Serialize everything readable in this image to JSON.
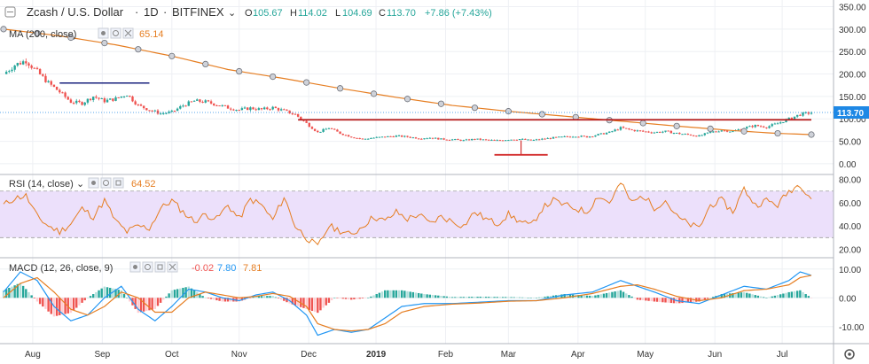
{
  "header": {
    "symbol": "Zcash / U.S. Dollar",
    "interval": "1D",
    "exchange": "BITFINEX",
    "sep": "·",
    "open_label": "O",
    "open": "105.67",
    "high_label": "H",
    "high": "114.02",
    "low_label": "L",
    "low": "104.69",
    "close_label": "C",
    "close": "113.70",
    "change": "+7.86 (+7.43%)"
  },
  "indicators": {
    "ma": {
      "label": "MA (200, close)",
      "value": "65.14"
    },
    "rsi": {
      "label": "RSI (14, close)",
      "value": "64.52"
    },
    "macd": {
      "label": "MACD (12, 26, close, 9)",
      "hist": "-0.02",
      "macd": "7.80",
      "signal": "7.81"
    }
  },
  "price_tag": "113.70",
  "colors": {
    "up": "#26a69a",
    "down": "#ef5350",
    "ma": "#e67e22",
    "rsi": "#e67e22",
    "macd_line": "#2196f3",
    "signal_line": "#e67e22",
    "rsi_band": "#ece0fb",
    "drawing_blue": "#1a237e",
    "drawing_red": "#b71c1c",
    "price_tag": "#1e88e5"
  },
  "chart_data": [
    {
      "type": "candlestick",
      "title": "Zcash / U.S. Dollar · 1D · BITFINEX",
      "x_labels": [
        "Aug",
        "Sep",
        "Oct",
        "Nov",
        "Dec",
        "2019",
        "Feb",
        "Mar",
        "Apr",
        "May",
        "Jun",
        "Jul"
      ],
      "yticks": [
        0,
        50,
        100,
        150,
        200,
        250,
        300,
        350
      ],
      "ytick_labels": [
        "0.00",
        "50.00",
        "100.00",
        "150.00",
        "200.00",
        "250.00",
        "300.00",
        "350.00"
      ],
      "ylim": [
        -10,
        355
      ],
      "close_series": [
        {
          "x": 0,
          "y": 200
        },
        {
          "x": 4,
          "y": 220
        },
        {
          "x": 8,
          "y": 230
        },
        {
          "x": 12,
          "y": 205
        },
        {
          "x": 16,
          "y": 180
        },
        {
          "x": 20,
          "y": 160
        },
        {
          "x": 24,
          "y": 138
        },
        {
          "x": 28,
          "y": 135
        },
        {
          "x": 32,
          "y": 150
        },
        {
          "x": 36,
          "y": 140
        },
        {
          "x": 40,
          "y": 145
        },
        {
          "x": 44,
          "y": 155
        },
        {
          "x": 48,
          "y": 130
        },
        {
          "x": 52,
          "y": 120
        },
        {
          "x": 56,
          "y": 112
        },
        {
          "x": 60,
          "y": 115
        },
        {
          "x": 64,
          "y": 130
        },
        {
          "x": 68,
          "y": 140
        },
        {
          "x": 72,
          "y": 138
        },
        {
          "x": 76,
          "y": 132
        },
        {
          "x": 80,
          "y": 125
        },
        {
          "x": 84,
          "y": 120
        },
        {
          "x": 88,
          "y": 124
        },
        {
          "x": 92,
          "y": 121
        },
        {
          "x": 96,
          "y": 125
        },
        {
          "x": 100,
          "y": 118
        },
        {
          "x": 104,
          "y": 110
        },
        {
          "x": 108,
          "y": 90
        },
        {
          "x": 112,
          "y": 70
        },
        {
          "x": 116,
          "y": 80
        },
        {
          "x": 120,
          "y": 68
        },
        {
          "x": 124,
          "y": 60
        },
        {
          "x": 128,
          "y": 55
        },
        {
          "x": 132,
          "y": 58
        },
        {
          "x": 136,
          "y": 60
        },
        {
          "x": 140,
          "y": 62
        },
        {
          "x": 144,
          "y": 60
        },
        {
          "x": 148,
          "y": 57
        },
        {
          "x": 152,
          "y": 58
        },
        {
          "x": 156,
          "y": 55
        },
        {
          "x": 160,
          "y": 54
        },
        {
          "x": 164,
          "y": 52
        },
        {
          "x": 168,
          "y": 55
        },
        {
          "x": 172,
          "y": 53
        },
        {
          "x": 176,
          "y": 52
        },
        {
          "x": 180,
          "y": 54
        },
        {
          "x": 184,
          "y": 55
        },
        {
          "x": 188,
          "y": 52
        },
        {
          "x": 192,
          "y": 55
        },
        {
          "x": 196,
          "y": 58
        },
        {
          "x": 200,
          "y": 60
        },
        {
          "x": 204,
          "y": 62
        },
        {
          "x": 208,
          "y": 60
        },
        {
          "x": 212,
          "y": 65
        },
        {
          "x": 216,
          "y": 70
        },
        {
          "x": 220,
          "y": 80
        },
        {
          "x": 224,
          "y": 75
        },
        {
          "x": 228,
          "y": 72
        },
        {
          "x": 232,
          "y": 70
        },
        {
          "x": 236,
          "y": 72
        },
        {
          "x": 240,
          "y": 68
        },
        {
          "x": 244,
          "y": 65
        },
        {
          "x": 248,
          "y": 62
        },
        {
          "x": 252,
          "y": 70
        },
        {
          "x": 256,
          "y": 75
        },
        {
          "x": 260,
          "y": 72
        },
        {
          "x": 264,
          "y": 80
        },
        {
          "x": 268,
          "y": 85
        },
        {
          "x": 272,
          "y": 82
        },
        {
          "x": 276,
          "y": 90
        },
        {
          "x": 280,
          "y": 100
        },
        {
          "x": 284,
          "y": 110
        },
        {
          "x": 288,
          "y": 114
        }
      ],
      "ma_series": [
        {
          "x": 0,
          "y": 300
        },
        {
          "x": 20,
          "y": 285
        },
        {
          "x": 40,
          "y": 265
        },
        {
          "x": 60,
          "y": 240
        },
        {
          "x": 80,
          "y": 210
        },
        {
          "x": 100,
          "y": 190
        },
        {
          "x": 120,
          "y": 168
        },
        {
          "x": 140,
          "y": 148
        },
        {
          "x": 160,
          "y": 130
        },
        {
          "x": 180,
          "y": 117
        },
        {
          "x": 200,
          "y": 106
        },
        {
          "x": 220,
          "y": 95
        },
        {
          "x": 240,
          "y": 84
        },
        {
          "x": 260,
          "y": 74
        },
        {
          "x": 275,
          "y": 68
        },
        {
          "x": 288,
          "y": 65
        }
      ],
      "drawings": {
        "blue_line": {
          "x1": 20,
          "x2": 52,
          "y": 180
        },
        "red_resistance": {
          "x1": 105,
          "x2": 288,
          "y": 98
        },
        "red_support": {
          "x1": 175,
          "x2": 194,
          "y": 20,
          "stem_top": 52
        }
      }
    },
    {
      "type": "line",
      "title": "RSI (14, close)",
      "yticks": [
        20,
        40,
        60,
        80
      ],
      "ytick_labels": [
        "20.00",
        "40.00",
        "60.00",
        "80.00"
      ],
      "ylim": [
        15,
        82
      ],
      "band": [
        30,
        70
      ],
      "series": [
        {
          "x": 0,
          "y": 58
        },
        {
          "x": 4,
          "y": 64
        },
        {
          "x": 8,
          "y": 66
        },
        {
          "x": 12,
          "y": 48
        },
        {
          "x": 16,
          "y": 40
        },
        {
          "x": 20,
          "y": 35
        },
        {
          "x": 24,
          "y": 42
        },
        {
          "x": 28,
          "y": 55
        },
        {
          "x": 32,
          "y": 48
        },
        {
          "x": 36,
          "y": 62
        },
        {
          "x": 40,
          "y": 44
        },
        {
          "x": 44,
          "y": 35
        },
        {
          "x": 48,
          "y": 40
        },
        {
          "x": 52,
          "y": 38
        },
        {
          "x": 56,
          "y": 55
        },
        {
          "x": 60,
          "y": 62
        },
        {
          "x": 64,
          "y": 52
        },
        {
          "x": 68,
          "y": 44
        },
        {
          "x": 72,
          "y": 50
        },
        {
          "x": 76,
          "y": 46
        },
        {
          "x": 80,
          "y": 58
        },
        {
          "x": 84,
          "y": 46
        },
        {
          "x": 88,
          "y": 63
        },
        {
          "x": 92,
          "y": 58
        },
        {
          "x": 96,
          "y": 45
        },
        {
          "x": 100,
          "y": 65
        },
        {
          "x": 104,
          "y": 40
        },
        {
          "x": 108,
          "y": 30
        },
        {
          "x": 112,
          "y": 22
        },
        {
          "x": 116,
          "y": 40
        },
        {
          "x": 120,
          "y": 36
        },
        {
          "x": 124,
          "y": 32
        },
        {
          "x": 128,
          "y": 40
        },
        {
          "x": 132,
          "y": 48
        },
        {
          "x": 136,
          "y": 44
        },
        {
          "x": 140,
          "y": 52
        },
        {
          "x": 144,
          "y": 46
        },
        {
          "x": 148,
          "y": 50
        },
        {
          "x": 152,
          "y": 42
        },
        {
          "x": 156,
          "y": 48
        },
        {
          "x": 160,
          "y": 44
        },
        {
          "x": 164,
          "y": 40
        },
        {
          "x": 168,
          "y": 52
        },
        {
          "x": 172,
          "y": 46
        },
        {
          "x": 176,
          "y": 42
        },
        {
          "x": 180,
          "y": 50
        },
        {
          "x": 184,
          "y": 44
        },
        {
          "x": 188,
          "y": 40
        },
        {
          "x": 192,
          "y": 55
        },
        {
          "x": 196,
          "y": 62
        },
        {
          "x": 200,
          "y": 58
        },
        {
          "x": 204,
          "y": 55
        },
        {
          "x": 208,
          "y": 52
        },
        {
          "x": 212,
          "y": 66
        },
        {
          "x": 216,
          "y": 60
        },
        {
          "x": 220,
          "y": 77
        },
        {
          "x": 224,
          "y": 60
        },
        {
          "x": 228,
          "y": 66
        },
        {
          "x": 232,
          "y": 56
        },
        {
          "x": 236,
          "y": 62
        },
        {
          "x": 240,
          "y": 48
        },
        {
          "x": 244,
          "y": 42
        },
        {
          "x": 248,
          "y": 38
        },
        {
          "x": 252,
          "y": 58
        },
        {
          "x": 256,
          "y": 62
        },
        {
          "x": 260,
          "y": 52
        },
        {
          "x": 264,
          "y": 72
        },
        {
          "x": 268,
          "y": 58
        },
        {
          "x": 272,
          "y": 62
        },
        {
          "x": 276,
          "y": 58
        },
        {
          "x": 280,
          "y": 70
        },
        {
          "x": 284,
          "y": 76
        },
        {
          "x": 288,
          "y": 64
        }
      ]
    },
    {
      "type": "line",
      "title": "MACD (12, 26, close, 9)",
      "yticks": [
        -10,
        0,
        10
      ],
      "ytick_labels": [
        "-10.00",
        "0.00",
        "10.00"
      ],
      "ylim": [
        -15,
        13
      ],
      "series": [
        {
          "name": "MACD",
          "points": [
            {
              "x": 0,
              "y": 2
            },
            {
              "x": 6,
              "y": 9
            },
            {
              "x": 12,
              "y": 6
            },
            {
              "x": 18,
              "y": -3
            },
            {
              "x": 24,
              "y": -8
            },
            {
              "x": 30,
              "y": -6
            },
            {
              "x": 36,
              "y": 0
            },
            {
              "x": 42,
              "y": 4
            },
            {
              "x": 48,
              "y": -4
            },
            {
              "x": 54,
              "y": -8
            },
            {
              "x": 60,
              "y": -3
            },
            {
              "x": 66,
              "y": 3
            },
            {
              "x": 72,
              "y": 2
            },
            {
              "x": 78,
              "y": 0
            },
            {
              "x": 84,
              "y": -1
            },
            {
              "x": 90,
              "y": 1
            },
            {
              "x": 96,
              "y": 2
            },
            {
              "x": 102,
              "y": -1
            },
            {
              "x": 108,
              "y": -6
            },
            {
              "x": 112,
              "y": -13
            },
            {
              "x": 118,
              "y": -11
            },
            {
              "x": 124,
              "y": -12
            },
            {
              "x": 130,
              "y": -11
            },
            {
              "x": 136,
              "y": -7
            },
            {
              "x": 142,
              "y": -3
            },
            {
              "x": 150,
              "y": -2
            },
            {
              "x": 160,
              "y": -2
            },
            {
              "x": 170,
              "y": -1.5
            },
            {
              "x": 180,
              "y": -1
            },
            {
              "x": 190,
              "y": -1
            },
            {
              "x": 200,
              "y": 1
            },
            {
              "x": 210,
              "y": 2
            },
            {
              "x": 220,
              "y": 6
            },
            {
              "x": 226,
              "y": 4
            },
            {
              "x": 232,
              "y": 2
            },
            {
              "x": 240,
              "y": -1
            },
            {
              "x": 248,
              "y": -2
            },
            {
              "x": 256,
              "y": 1
            },
            {
              "x": 264,
              "y": 4
            },
            {
              "x": 272,
              "y": 3
            },
            {
              "x": 280,
              "y": 6
            },
            {
              "x": 284,
              "y": 9
            },
            {
              "x": 288,
              "y": 7.8
            }
          ]
        },
        {
          "name": "Signal",
          "points": [
            {
              "x": 0,
              "y": 0
            },
            {
              "x": 6,
              "y": 5
            },
            {
              "x": 12,
              "y": 7
            },
            {
              "x": 18,
              "y": 2
            },
            {
              "x": 24,
              "y": -4
            },
            {
              "x": 30,
              "y": -6
            },
            {
              "x": 36,
              "y": -3
            },
            {
              "x": 42,
              "y": 2
            },
            {
              "x": 48,
              "y": 0
            },
            {
              "x": 54,
              "y": -5
            },
            {
              "x": 60,
              "y": -5
            },
            {
              "x": 66,
              "y": 0
            },
            {
              "x": 72,
              "y": 2
            },
            {
              "x": 78,
              "y": 1
            },
            {
              "x": 84,
              "y": 0
            },
            {
              "x": 90,
              "y": 0.5
            },
            {
              "x": 96,
              "y": 1.5
            },
            {
              "x": 102,
              "y": 0.5
            },
            {
              "x": 108,
              "y": -3
            },
            {
              "x": 112,
              "y": -9
            },
            {
              "x": 118,
              "y": -11
            },
            {
              "x": 124,
              "y": -11.5
            },
            {
              "x": 130,
              "y": -11
            },
            {
              "x": 136,
              "y": -9
            },
            {
              "x": 142,
              "y": -5
            },
            {
              "x": 150,
              "y": -3
            },
            {
              "x": 160,
              "y": -2.2
            },
            {
              "x": 170,
              "y": -1.8
            },
            {
              "x": 180,
              "y": -1.2
            },
            {
              "x": 190,
              "y": -1
            },
            {
              "x": 200,
              "y": 0
            },
            {
              "x": 210,
              "y": 1.5
            },
            {
              "x": 220,
              "y": 4
            },
            {
              "x": 226,
              "y": 4.5
            },
            {
              "x": 232,
              "y": 3
            },
            {
              "x": 240,
              "y": 0.5
            },
            {
              "x": 248,
              "y": -1
            },
            {
              "x": 256,
              "y": 0
            },
            {
              "x": 264,
              "y": 2.5
            },
            {
              "x": 272,
              "y": 3
            },
            {
              "x": 280,
              "y": 4.5
            },
            {
              "x": 284,
              "y": 7
            },
            {
              "x": 288,
              "y": 7.81
            }
          ]
        }
      ]
    }
  ]
}
